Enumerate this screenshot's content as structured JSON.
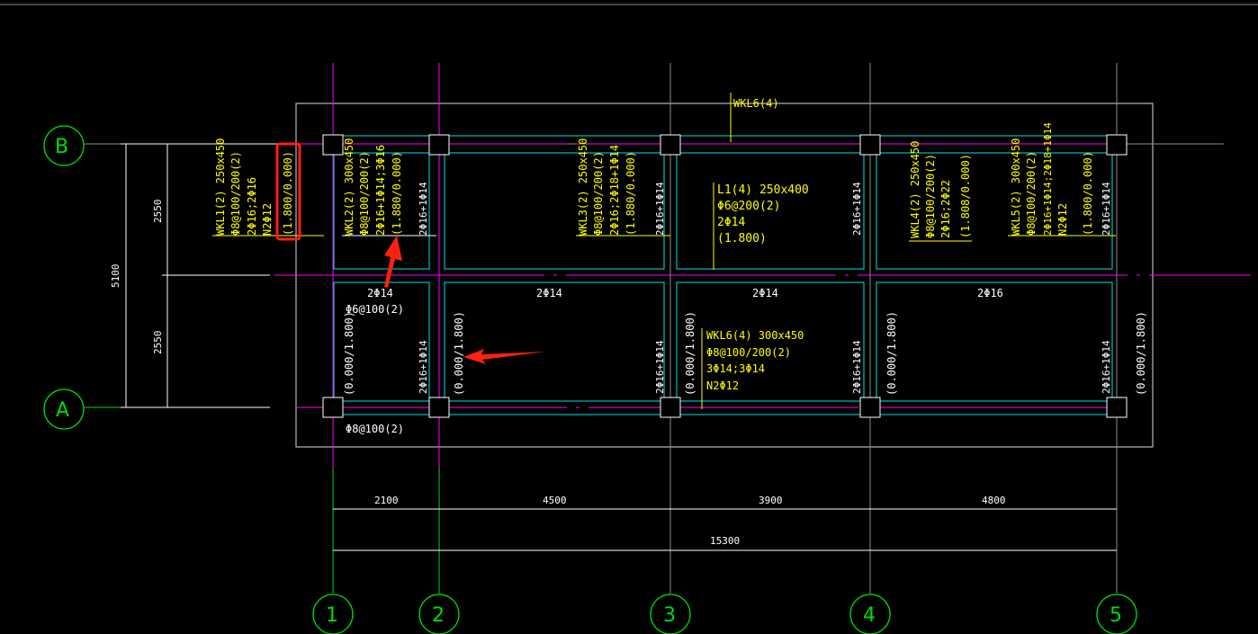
{
  "colors": {
    "background": "#000000",
    "grid_line": "#8c8c8c",
    "beam_edge": "#00e5e5",
    "center_line": "#ff00ff",
    "axis_bubble": "#00dd00",
    "annotation": "#ffff00",
    "text": "#ffffff",
    "highlight": "#ff2010"
  },
  "axes": {
    "rows": [
      "B",
      "A"
    ],
    "columns": [
      "1",
      "2",
      "3",
      "4",
      "5"
    ]
  },
  "dimensions": {
    "left_total": "5100",
    "left_upper": "2550",
    "left_lower": "2550",
    "spans": [
      "2100",
      "4500",
      "3900",
      "4800"
    ],
    "total": "15300"
  },
  "beams": {
    "wkl1": [
      "WKL1(2) 250x450",
      "Φ8@100/200(2)",
      "2Φ16;2Φ16",
      "N2Φ12",
      "(1.800/0.000)"
    ],
    "wkl2": [
      "WKL2(2) 300x450",
      "Φ8@100/200(2)",
      "2Φ16+1Φ14;3Φ16",
      "(1.880/0.000)"
    ],
    "wkl3": [
      "WKL3(2) 250x450",
      "Φ8@100/200(2)",
      "2Φ16;2Φ18+1Φ14",
      "(1.880/0.000)"
    ],
    "l1": [
      "L1(4) 250x400",
      "Φ6@200(2)",
      "2Φ14",
      "(1.800)"
    ],
    "wkl4": [
      "WKL4(2) 250x450",
      "Φ8@100/200(2)",
      "2Φ16;2Φ22",
      "(1.808/0.000)"
    ],
    "wkl5": [
      "WKL5(2) 300x450",
      "Φ8@100/200(2)",
      "2Φ16+1Φ14;2Φ18+1Φ14",
      "N2Φ12",
      "(1.800/0.000)"
    ],
    "wkl6_top": "WKL6(4)",
    "wkl6": [
      "WKL6(4) 300x450",
      "Φ8@100/200(2)",
      "3Φ14;3Φ14",
      "N2Φ12"
    ]
  },
  "labels": {
    "support_rebar": "2Φ16+1Φ14",
    "elevation": "(0.000/1.800)",
    "bottom_2phi14": "2Φ14",
    "bottom_2phi16": "2Φ16",
    "stirrup_6": "Φ6@100(2)",
    "stirrup_8": "Φ8@100(2)"
  }
}
